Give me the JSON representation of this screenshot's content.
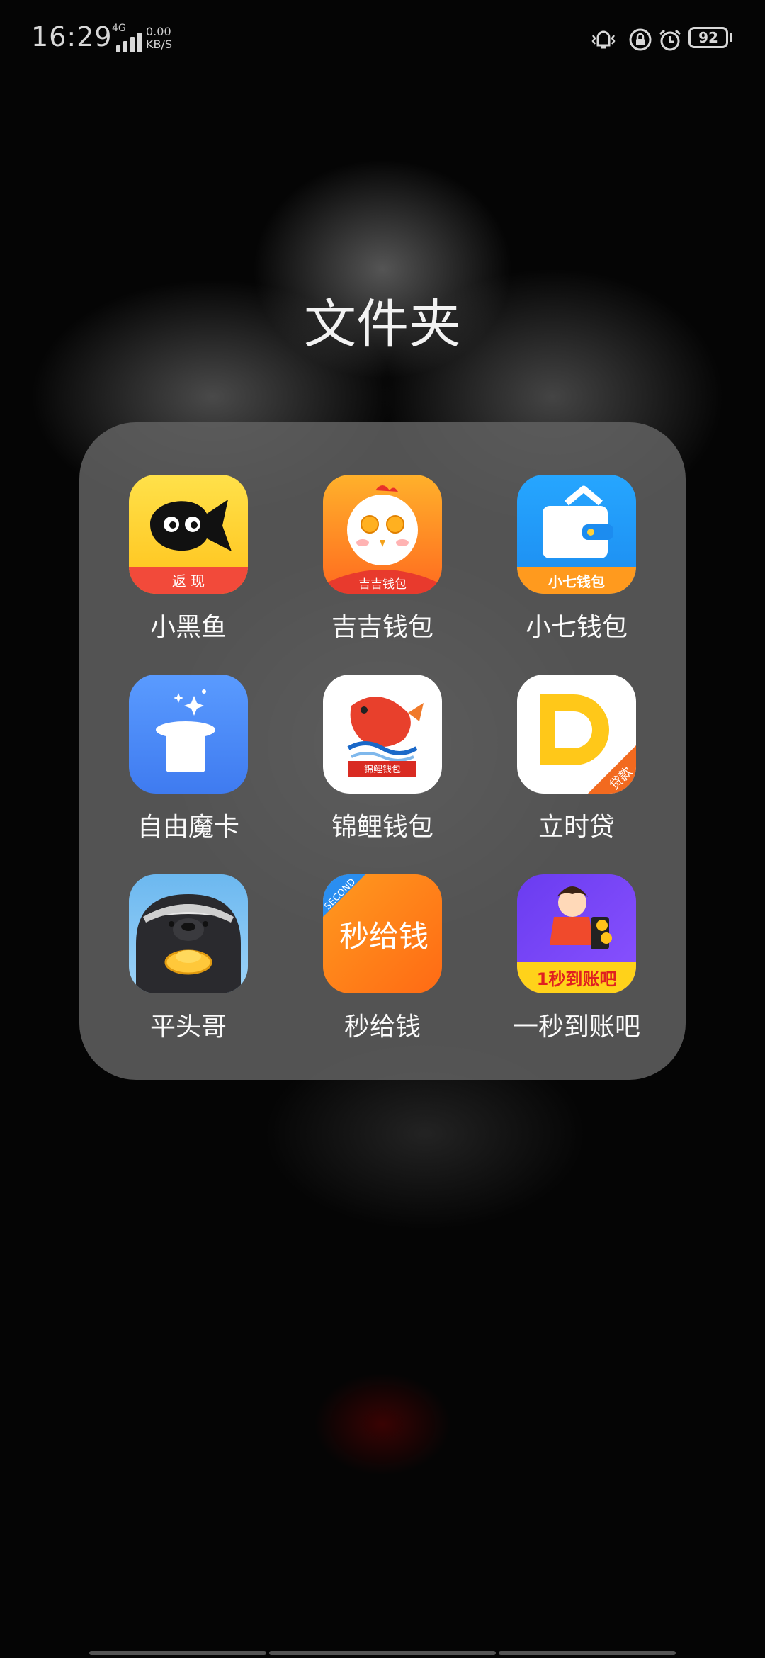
{
  "status_bar": {
    "time": "16:29",
    "network_type": "4G",
    "speed_value": "0.00",
    "speed_unit": "KB/S",
    "battery": "92",
    "icons": [
      "vibrate-icon",
      "rotation-lock-icon",
      "alarm-icon",
      "battery-icon"
    ]
  },
  "folder": {
    "title": "文件夹",
    "apps": [
      {
        "label": "小黑鱼",
        "icon": "xiaoheiyu-icon",
        "badge": "返 现"
      },
      {
        "label": "吉吉钱包",
        "icon": "jiji-wallet-icon",
        "badge": "吉吉钱包"
      },
      {
        "label": "小七钱包",
        "icon": "xiaoqi-wallet-icon",
        "badge": "小七钱包"
      },
      {
        "label": "自由魔卡",
        "icon": "ziyou-moka-icon",
        "badge": ""
      },
      {
        "label": "锦鲤钱包",
        "icon": "jinli-wallet-icon",
        "badge": "锦鲤钱包"
      },
      {
        "label": "立时贷",
        "icon": "lishidai-icon",
        "badge": "贷款"
      },
      {
        "label": "平头哥",
        "icon": "pingtouge-icon",
        "badge": ""
      },
      {
        "label": "秒给钱",
        "icon": "miaogeiqian-icon",
        "badge": "SECOND",
        "art": "秒给钱"
      },
      {
        "label": "一秒到账吧",
        "icon": "yimiao-daozhang-icon",
        "badge": "1秒到账吧"
      }
    ]
  },
  "colors": {
    "background": "#000000",
    "folder_panel": "#5f5f5f",
    "text": "#ffffff"
  }
}
